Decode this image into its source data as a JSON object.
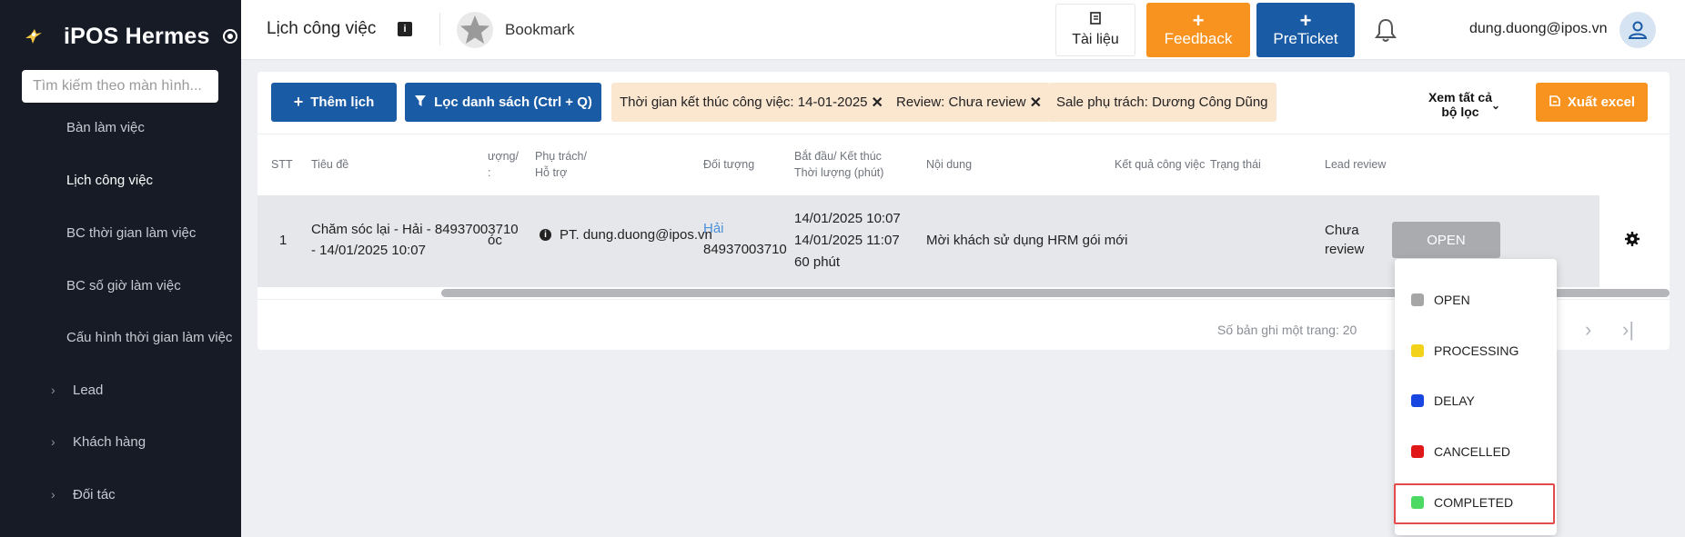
{
  "sidebar": {
    "brand": "iPOS Hermes",
    "search_placeholder": "Tìm kiếm theo màn hình...",
    "items": [
      {
        "label": "Bàn làm việc"
      },
      {
        "label": "Lịch công việc"
      },
      {
        "label": "BC thời gian làm việc"
      },
      {
        "label": "BC số giờ làm việc"
      },
      {
        "label": "Cấu hình thời gian làm việc"
      },
      {
        "label": "Lead"
      },
      {
        "label": "Khách hàng"
      },
      {
        "label": "Đối tác"
      }
    ]
  },
  "header": {
    "title": "Lịch công việc",
    "info_icon": "i",
    "bookmark": "Bookmark",
    "docs_label": "Tài liệu",
    "feedback_label": "Feedback",
    "preticket_label": "PreTicket",
    "plus": "+",
    "user_email": "dung.duong@ipos.vn"
  },
  "toolbar": {
    "add_label": "Thêm lịch",
    "filter_label": "Lọc danh sách (Ctrl + Q)",
    "chips": [
      "Thời gian kết thúc công việc: 14-01-2025",
      "Review: Chưa review",
      "Sale phụ trách: Dương Công Dũng"
    ],
    "chip_close": "✕",
    "view_all": "Xem tất cả bộ lọc",
    "excel_label": "Xuất excel"
  },
  "table": {
    "headers": {
      "stt": "STT",
      "title": "Tiêu đề",
      "partial_a": "ượng/",
      "partial_b": ":",
      "owner_1": "Phụ trách/",
      "owner_2": "Hỗ trợ",
      "object": "Đối tượng",
      "time_1": "Bắt đầu/ Kết thúc",
      "time_2": "Thời lượng (phút)",
      "content": "Nội dung",
      "result": "Kết quả công việc",
      "status": "Trạng thái",
      "lead_review": "Lead review"
    },
    "row": {
      "stt": "1",
      "title_1": "Chăm sóc lại - Hải - 84937003710",
      "title_2": "- 14/01/2025 10:07",
      "partial": "óc",
      "owner": "PT. dung.duong@ipos.vn",
      "object_name": "Hải",
      "object_phone": "84937003710",
      "start": "14/01/2025 10:07",
      "end": "14/01/2025 11:07",
      "duration": "60 phút",
      "content": "Mời khách sử dụng HRM gói mới",
      "status": "OPEN",
      "lead_review_1": "Chưa",
      "lead_review_2": "review"
    }
  },
  "pagination": {
    "per_page": "Số bản ghi một trang: 20",
    "next": "›",
    "last": "›|"
  },
  "status_dropdown": {
    "options": [
      {
        "label": "OPEN",
        "color": "#a6a6a6"
      },
      {
        "label": "PROCESSING",
        "color": "#f2d21b"
      },
      {
        "label": "DELAY",
        "color": "#1846e0"
      },
      {
        "label": "CANCELLED",
        "color": "#e01818"
      },
      {
        "label": "COMPLETED",
        "color": "#4cd964"
      }
    ]
  }
}
